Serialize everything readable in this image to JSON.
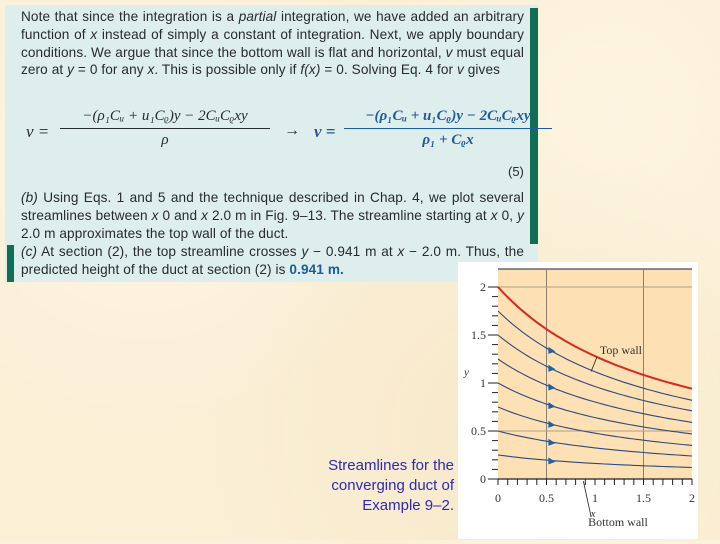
{
  "document": {
    "paragraph1": {
      "s1": "Note that since the integration is a ",
      "s1_italic": "partial",
      "s2": " integration, we have added an arbitrary function of ",
      "s2_var": "x",
      "s3": " instead of simply a constant of integration. Next, we apply boundary conditions. We argue that since the bottom wall is flat and horizontal, ",
      "s3_var": "v",
      "s4": " must equal zero at ",
      "s4_var": "y",
      "s5": " = 0 for any ",
      "s5_var": "x",
      "s6": ". This is possible only if ",
      "s6_var": "f(x)",
      "s7": " = 0. Solving Eq. 4 for ",
      "s7_var": "v",
      "s8": " gives"
    },
    "equation": {
      "lhs": "v =",
      "frac1_num": "−(ρ₁Cᵤ + u₁Cᵨ)y − 2CᵤCᵨxy",
      "frac1_den": "ρ",
      "arrow": "→",
      "rhs": "v =",
      "frac2_num": "−(ρ₁Cᵤ + u₁Cᵨ)y − 2CᵤCᵨxy",
      "frac2_den": "ρ₁ + Cᵨx",
      "number": "(5)"
    },
    "paragraph2": {
      "label": "(b)",
      "s1": " Using Eqs. 1 and 5 and the technique described in Chap. 4, we plot several streamlines between ",
      "v1": "x",
      "s2": "  0 and ",
      "v2": "x",
      "s3": "  2.0 m in Fig. 9–13. The streamline starting at ",
      "v3": "x",
      "s4": "  0, ",
      "v4": "y",
      "s5": "  2.0 m approximates the top wall of the duct."
    },
    "paragraph3": {
      "label": "(c)",
      "s1": " At section (2), the top streamline crosses ",
      "v1": "y",
      "s2": " − 0.941 m at ",
      "v2": "x",
      "s3": " − 2.0 m. Thus, the predicted height of the duct at section (2) is ",
      "result": "0.941 m."
    }
  },
  "caption": {
    "line1": "Streamlines for the",
    "line2": "converging duct of",
    "line3": "Example 9–2."
  },
  "chart_data": {
    "type": "line",
    "title": "",
    "xlabel": "x",
    "ylabel": "y",
    "xlim": [
      0,
      2
    ],
    "ylim": [
      0,
      2
    ],
    "xticks": [
      "0",
      "0.5",
      "1",
      "1.5",
      "2"
    ],
    "yticks": [
      "0",
      "0.5",
      "1",
      "1.5",
      "2"
    ],
    "grid_lines_x": [
      0.5,
      1.5
    ],
    "grid_lines_y": [
      0.5,
      2
    ],
    "series": [
      {
        "name": "Top wall",
        "color": "#d42a1e",
        "y_start": 2.0,
        "y_end": 0.941
      },
      {
        "name": "streamline",
        "color": "#2c4a80",
        "y_start": 1.75,
        "y_end": 0.82
      },
      {
        "name": "streamline",
        "color": "#2c4a80",
        "y_start": 1.5,
        "y_end": 0.71
      },
      {
        "name": "streamline",
        "color": "#2c4a80",
        "y_start": 1.25,
        "y_end": 0.59
      },
      {
        "name": "streamline",
        "color": "#2c4a80",
        "y_start": 1.0,
        "y_end": 0.47
      },
      {
        "name": "streamline",
        "color": "#2c4a80",
        "y_start": 0.75,
        "y_end": 0.35
      },
      {
        "name": "streamline",
        "color": "#2c4a80",
        "y_start": 0.5,
        "y_end": 0.24
      },
      {
        "name": "streamline",
        "color": "#2c4a80",
        "y_start": 0.25,
        "y_end": 0.12
      }
    ],
    "arrow_x": 0.53,
    "annotations": [
      {
        "text": "Top wall",
        "x": 1.12,
        "y": 1.3
      },
      {
        "text": "Bottom wall",
        "x": 1.35,
        "y": -0.45
      }
    ],
    "plot_background": "#fde0b4"
  }
}
